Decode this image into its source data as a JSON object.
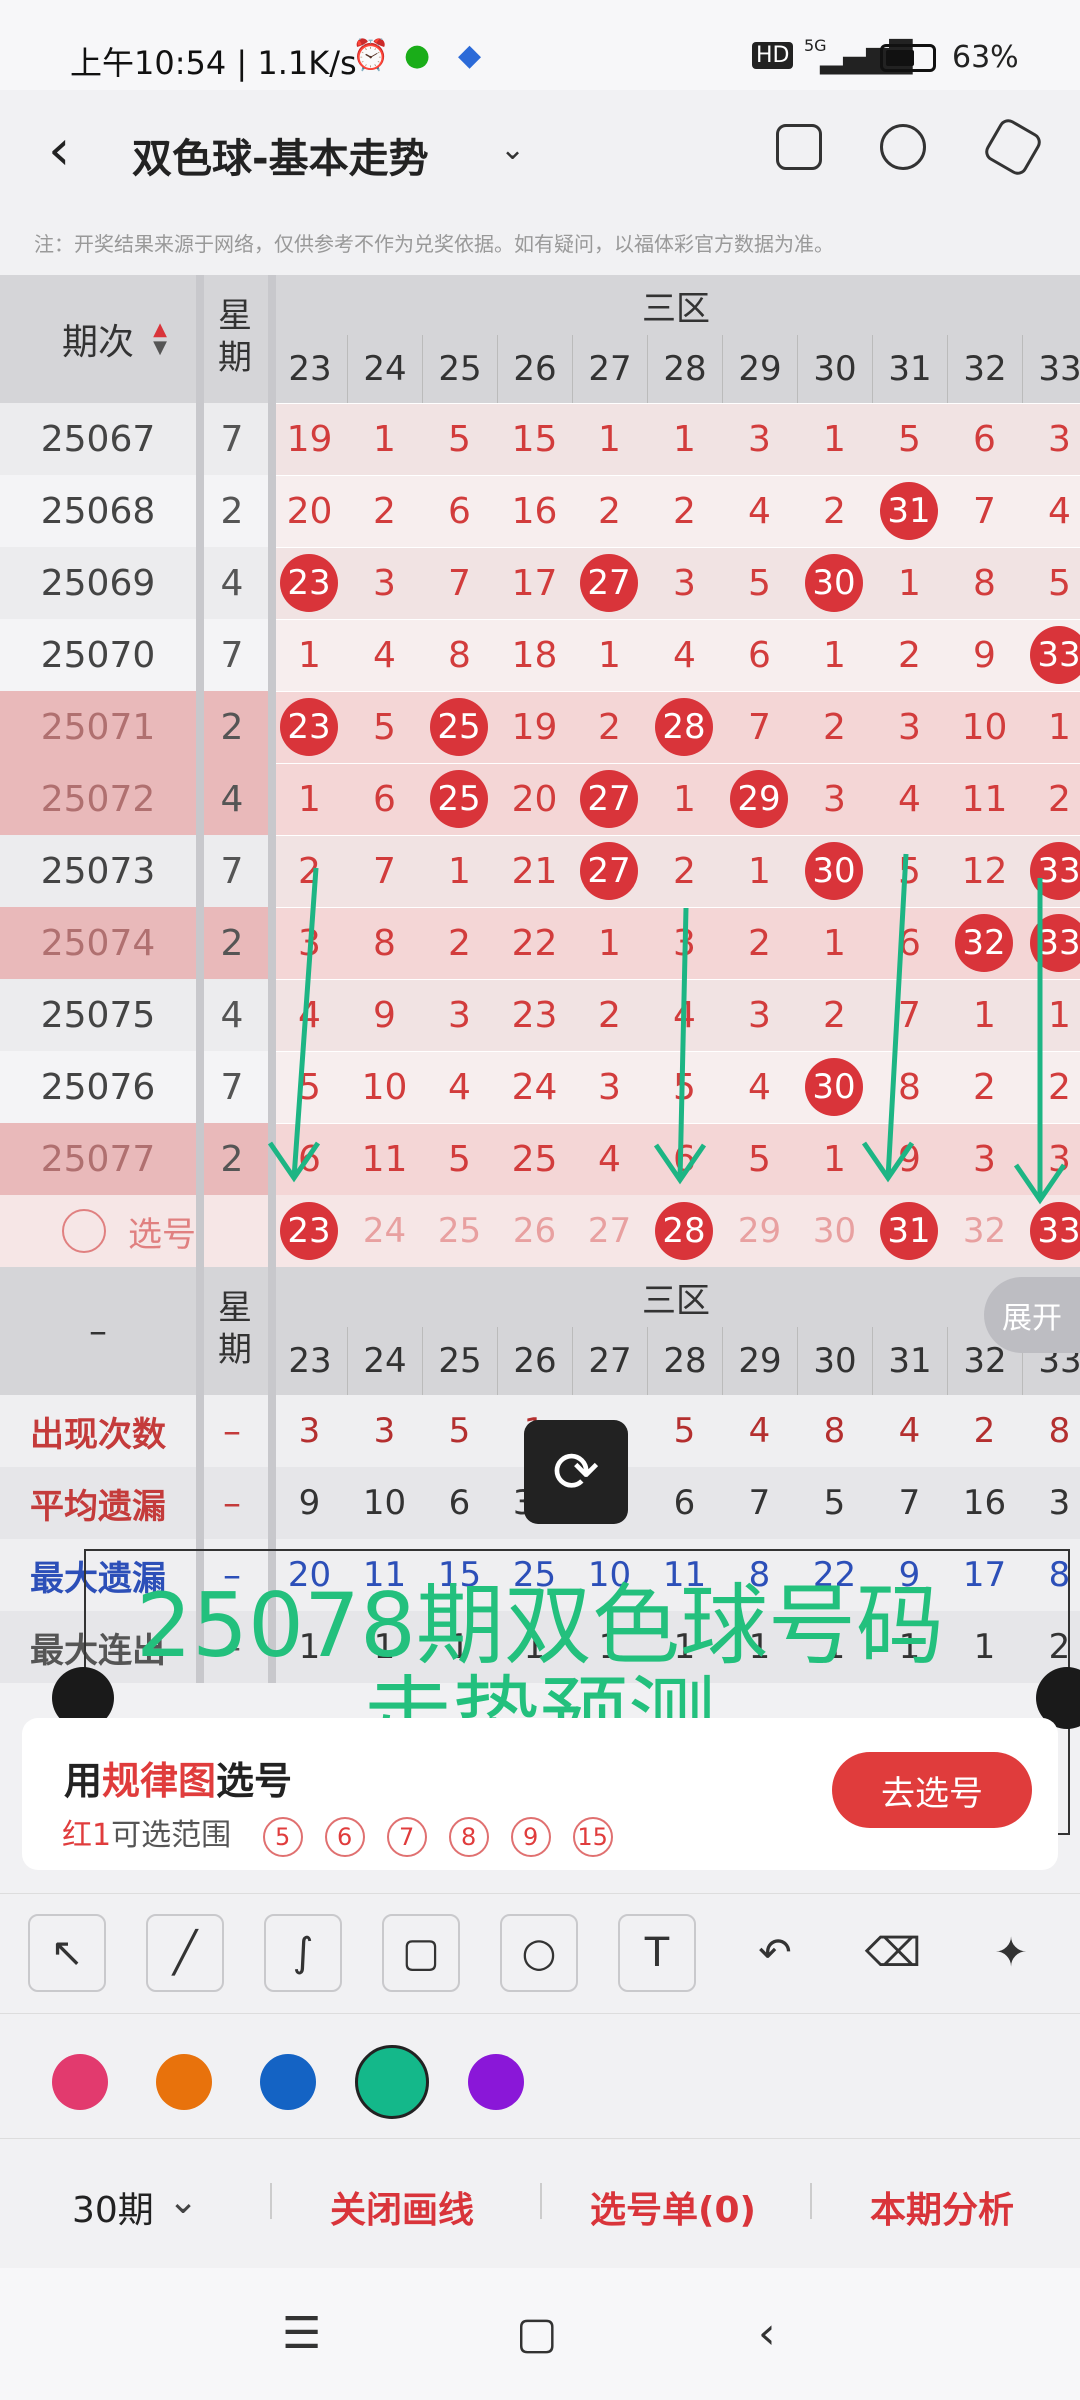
{
  "status_bar": {
    "time": "上午10:54 | 1.1K/s",
    "signal": "5G",
    "battery": "63%"
  },
  "header": {
    "title": "双色球-基本走势",
    "icons": [
      "back-icon",
      "phone-icon",
      "share-icon",
      "settings-icon"
    ]
  },
  "notice": "注：开奖结果来源于网络，仅供参考不作为兑奖依据。如有疑问，以福体彩官方数据为准。",
  "table": {
    "col_issue": "期次",
    "col_week": "星期",
    "zone": "三区",
    "numbers": [
      "23",
      "24",
      "25",
      "26",
      "27",
      "28",
      "29",
      "30",
      "31",
      "32",
      "33"
    ],
    "rows": [
      {
        "issue": "25067",
        "week": "7",
        "cells": [
          "19",
          "1",
          "5",
          "15",
          "1",
          "1",
          "3",
          "1",
          "5",
          "6",
          "3"
        ],
        "hl": false
      },
      {
        "issue": "25068",
        "week": "2",
        "cells": [
          "20",
          "2",
          "6",
          "16",
          "2",
          "2",
          "4",
          "2",
          "31",
          "7",
          "4"
        ],
        "hl": false
      },
      {
        "issue": "25069",
        "week": "4",
        "cells": [
          "23",
          "3",
          "7",
          "17",
          "27",
          "3",
          "5",
          "30",
          "1",
          "8",
          "5"
        ],
        "hl": false
      },
      {
        "issue": "25070",
        "week": "7",
        "cells": [
          "1",
          "4",
          "8",
          "18",
          "1",
          "4",
          "6",
          "1",
          "2",
          "9",
          "33"
        ],
        "hl": false
      },
      {
        "issue": "25071",
        "week": "2",
        "cells": [
          "23",
          "5",
          "25",
          "19",
          "2",
          "28",
          "7",
          "2",
          "3",
          "10",
          "1"
        ],
        "hl": true
      },
      {
        "issue": "25072",
        "week": "4",
        "cells": [
          "1",
          "6",
          "25",
          "20",
          "27",
          "1",
          "29",
          "3",
          "4",
          "11",
          "2"
        ],
        "hl": true
      },
      {
        "issue": "25073",
        "week": "7",
        "cells": [
          "2",
          "7",
          "1",
          "21",
          "27",
          "2",
          "1",
          "30",
          "5",
          "12",
          "33"
        ],
        "hl": false
      },
      {
        "issue": "25074",
        "week": "2",
        "cells": [
          "3",
          "8",
          "2",
          "22",
          "1",
          "3",
          "2",
          "1",
          "6",
          "32",
          "33"
        ],
        "hl": true
      },
      {
        "issue": "25075",
        "week": "4",
        "cells": [
          "4",
          "9",
          "3",
          "23",
          "2",
          "4",
          "3",
          "2",
          "7",
          "1",
          "1"
        ],
        "hl": false
      },
      {
        "issue": "25076",
        "week": "7",
        "cells": [
          "5",
          "10",
          "4",
          "24",
          "3",
          "5",
          "4",
          "30",
          "8",
          "2",
          "2"
        ],
        "hl": false
      },
      {
        "issue": "25077",
        "week": "2",
        "cells": [
          "6",
          "11",
          "5",
          "25",
          "4",
          "6",
          "5",
          "1",
          "9",
          "3",
          "3"
        ],
        "hl": true
      }
    ],
    "select_label": "选号",
    "select_cells": [
      "23",
      "24",
      "25",
      "26",
      "27",
      "28",
      "29",
      "30",
      "31",
      "32",
      "33"
    ],
    "stats_dash": "–",
    "stats_week": "星期",
    "expand": "展开",
    "stats": [
      {
        "label": "出现次数",
        "week": "–",
        "vals": [
          "3",
          "3",
          "5",
          "1",
          "",
          "5",
          "4",
          "8",
          "4",
          "2",
          "8"
        ]
      },
      {
        "label": "平均遗漏",
        "week": "–",
        "vals": [
          "9",
          "10",
          "6",
          "38",
          "3",
          "6",
          "7",
          "5",
          "7",
          "16",
          "3"
        ]
      },
      {
        "label": "最大遗漏",
        "week": "–",
        "vals": [
          "20",
          "11",
          "15",
          "25",
          "10",
          "11",
          "8",
          "22",
          "9",
          "17",
          "8"
        ]
      },
      {
        "label": "最大连出",
        "week": "–",
        "vals": [
          "1",
          "1",
          "1",
          "1",
          "1",
          "1",
          "1",
          "1",
          "1",
          "1",
          "2"
        ]
      }
    ]
  },
  "overlay_text": [
    "25078期双色球号码",
    "走势预测"
  ],
  "promo": {
    "title_a": "用",
    "title_b": "规律图",
    "title_c": "选号",
    "sub_a": "红1",
    "sub_b": "可选范围",
    "options": [
      "5",
      "6",
      "7",
      "8",
      "9",
      "15"
    ],
    "button": "去选号"
  },
  "tools": [
    "arrow-tool-icon",
    "line-tool-icon",
    "freehand-tool-icon",
    "rectangle-tool-icon",
    "circle-tool-icon",
    "text-tool-icon",
    "undo-icon",
    "eraser-icon",
    "clear-icon"
  ],
  "palette": [
    "#e23a6e",
    "#e8720c",
    "#1463c4",
    "#14b88a",
    "#8a17d8"
  ],
  "footer": {
    "period": "30期",
    "close_draw": "关闭画线",
    "pick_list": "选号单(0)",
    "analysis": "本期分析"
  }
}
